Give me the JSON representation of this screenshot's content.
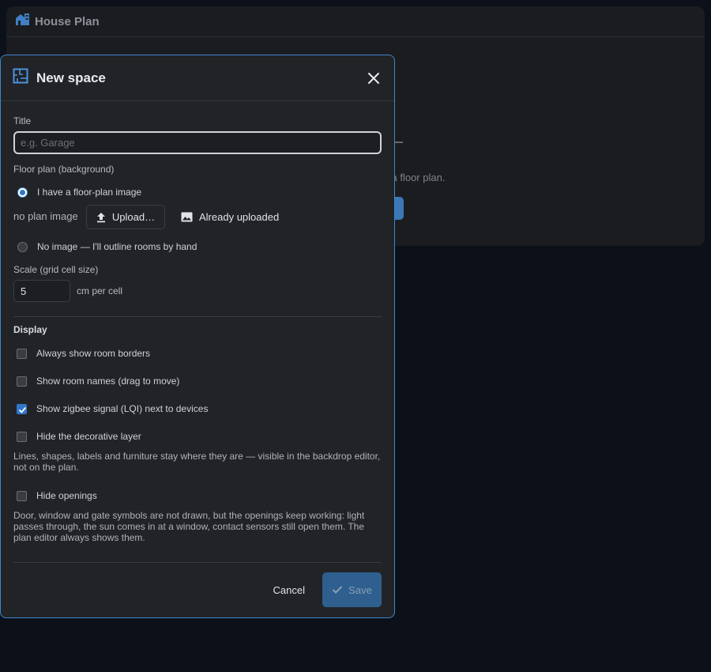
{
  "background": {
    "app_title": "House Plan",
    "hint_text": "l a floor plan."
  },
  "dialog": {
    "title": "New space",
    "title_field": {
      "label": "Title",
      "placeholder": "e.g. Garage",
      "value": ""
    },
    "floor_plan": {
      "label": "Floor plan (background)",
      "option_image": "I have a floor-plan image",
      "no_plan_text": "no plan image",
      "upload_label": "Upload…",
      "already_uploaded_label": "Already uploaded",
      "option_no_image": "No image — I'll outline rooms by hand",
      "selected": "image"
    },
    "scale": {
      "label": "Scale (grid cell size)",
      "value": "5",
      "unit": "cm per cell"
    },
    "display": {
      "title": "Display",
      "options": [
        {
          "label": "Always show room borders",
          "checked": false
        },
        {
          "label": "Show room names (drag to move)",
          "checked": false
        },
        {
          "label": "Show zigbee signal (LQI) next to devices",
          "checked": true
        },
        {
          "label": "Hide the decorative layer",
          "checked": false
        },
        {
          "label": "Hide openings",
          "checked": false
        }
      ],
      "decorative_note": "Lines, shapes, labels and furniture stay where they are — visible in the backdrop editor, not on the plan.",
      "openings_note": "Door, window and gate symbols are not drawn, but the openings keep working: light passes through, the sun comes in at a window, contact sensors still open them. The plan editor always shows them."
    },
    "footer": {
      "cancel_label": "Cancel",
      "save_label": "Save"
    }
  },
  "colors": {
    "accent": "#2f78c8",
    "dialog_border": "#3e86cc",
    "save_disabled": "#2e5f8f"
  }
}
